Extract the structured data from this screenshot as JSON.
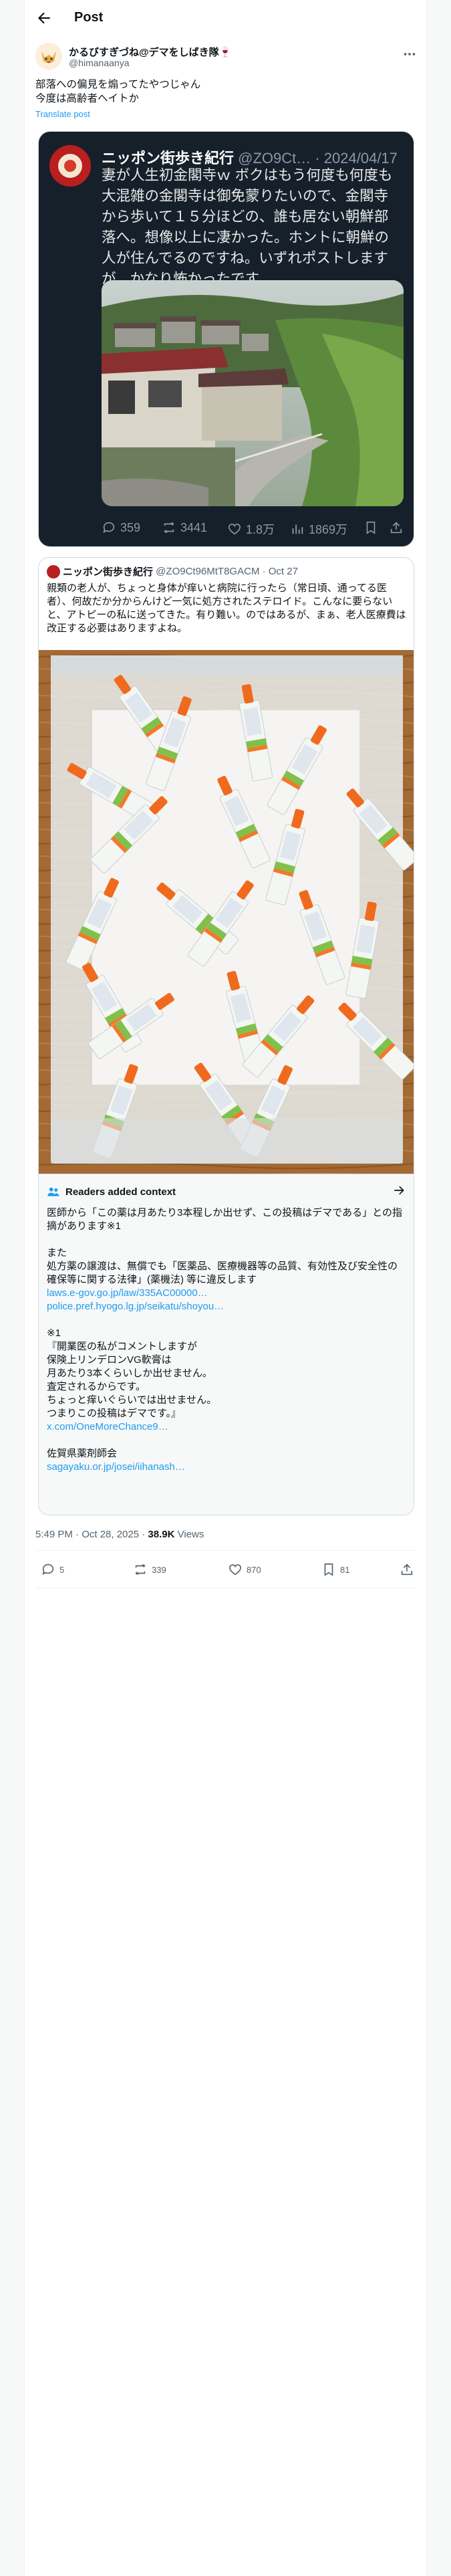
{
  "header": {
    "title": "Post"
  },
  "author": {
    "name": "かるびすぎづね@デマをしばき隊🍷",
    "handle": "@himanaanya"
  },
  "tweet": {
    "line1": "部落への偏見を煽ってたやつじゃん",
    "line2": "今度は高齢者ヘイトか",
    "translate": "Translate post"
  },
  "screenshot": {
    "name": "ニッポン街歩き紀行",
    "meta": " @ZO9Ct… · 2024/04/17",
    "text": "妻が人生初金閣寺ｗ ボクはもう何度も何度も大混雑の金閣寺は御免蒙りたいので、金閣寺から歩いて１５分ほどの、誰も居ない朝鮮部落へ。想像以上に凄かった。ホントに朝鮮の人が住んでるのですね。いずれポストしますが、かなり怖かったです。",
    "replies": "359",
    "reposts": "3441",
    "likes": "1.8万",
    "views": "1869万"
  },
  "quote": {
    "name": "ニッポン街歩き紀行",
    "meta": " @ZO9Ct96MtT8GACM · Oct 27",
    "text": "親類の老人が、ちょっと身体が痒いと病院に行ったら（常日頃、通ってる医者）、何故だか分からんけど一気に処方されたステロイド。こんなに要らないと、アトピーの私に送ってきた。有り難い。のではあるが、まぁ、老人医療費は改正する必要はありますよね。"
  },
  "note": {
    "title": "Readers added context",
    "p1": "医師から「この薬は月あたり3本程しか出せず、この投稿はデマである」との指摘があります※1",
    "p2": "また\n処方薬の譲渡は、無償でも「医薬品、医療機器等の品質、有効性及び安全性の確保等に関する法律」(薬機法) 等に違反します",
    "link1": "laws.e-gov.go.jp/law/335AC00000…",
    "link2": "police.pref.hyogo.lg.jp/seikatu/shoyou…",
    "p3": "※1\n『開業医の私がコメントしますが\n保険上リンデロンVG軟膏は\n月あたり3本くらいしか出せません。\n査定されるからです。\nちょっと痒いぐらいでは出せません。\nつまりこの投稿はデマです。』",
    "link3": "x.com/OneMoreChance9…",
    "p4": "佐賀県薬剤師会",
    "link4": "sagayaku.or.jp/josei/iihanash…"
  },
  "post_meta": {
    "time": "5:49 PM · Oct 28, 2025 · ",
    "views": "38.9K",
    "views_label": " Views"
  },
  "stats": {
    "replies": "5",
    "reposts": "339",
    "likes": "870",
    "bookmarks": "81"
  },
  "colors": {
    "accent": "#1d9bf0",
    "muted": "#536471",
    "dark_card": "#16202a"
  }
}
